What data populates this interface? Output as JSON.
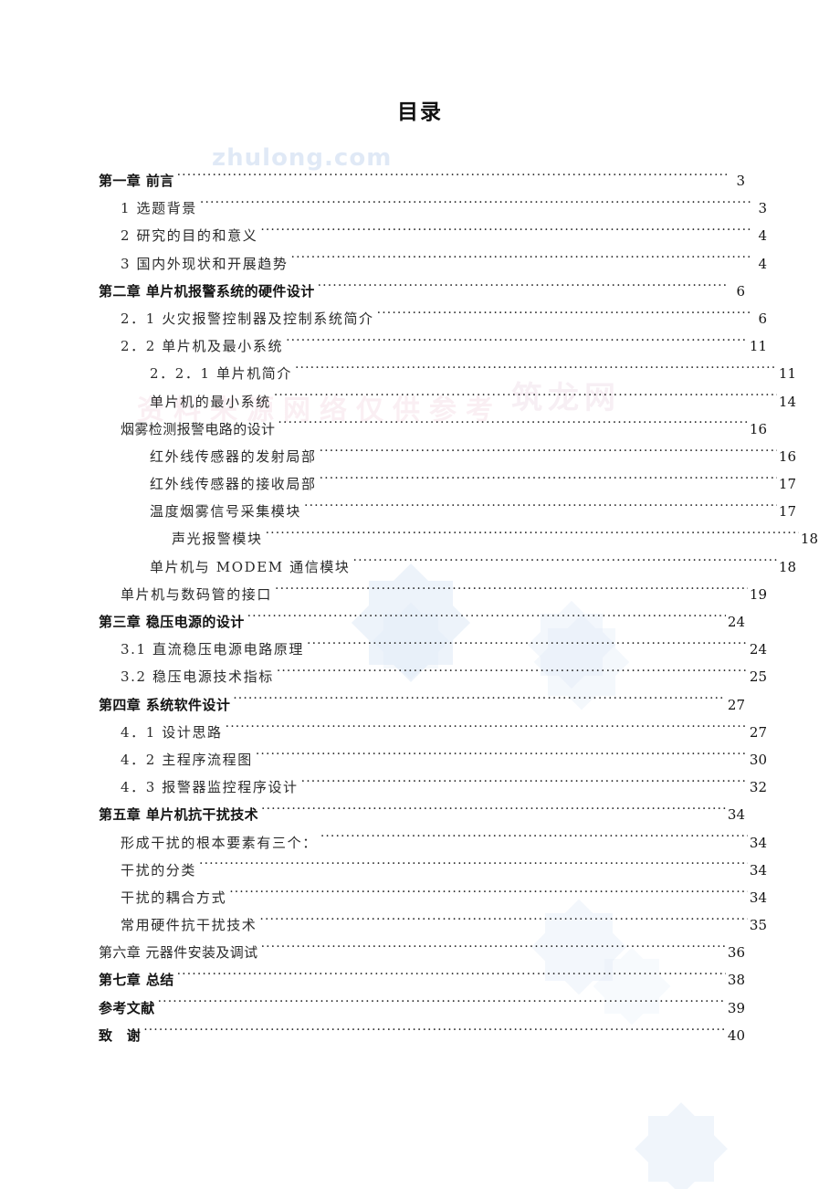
{
  "document": {
    "title": "目录",
    "watermarks": {
      "site": "zhulong.com",
      "band_left": "资料来源网络仅供参考",
      "band_right": "筑龙网"
    }
  },
  "toc": {
    "entries": [
      {
        "label": "第一章  前言",
        "page": "3",
        "level": 0,
        "bold": true,
        "tight": true
      },
      {
        "label": "1 选题背景",
        "page": "3",
        "level": 1,
        "bold": false,
        "tight": false
      },
      {
        "label": "2 研究的目的和意义",
        "page": "4",
        "level": 1,
        "bold": false,
        "tight": false
      },
      {
        "label": "3 国内外现状和开展趋势",
        "page": "4",
        "level": 1,
        "bold": false,
        "tight": false
      },
      {
        "label": "第二章  单片机报警系统的硬件设计",
        "page": "6",
        "level": 0,
        "bold": true,
        "tight": true
      },
      {
        "label": "2．1 火灾报警控制器及控制系统简介",
        "page": "6",
        "level": 1,
        "bold": false,
        "tight": false
      },
      {
        "label": "2．2 单片机及最小系统",
        "page": "11",
        "level": 1,
        "bold": false,
        "tight": false
      },
      {
        "label": "2．2．1 单片机简介",
        "page": "11",
        "level": 2,
        "bold": false,
        "tight": false
      },
      {
        "label": "单片机的最小系统",
        "page": "14",
        "level": 2,
        "bold": false,
        "tight": false
      },
      {
        "label": "烟雾检测报警电路的设计",
        "page": "16",
        "level": 1,
        "bold": false,
        "tight": true
      },
      {
        "label": "红外线传感器的发射局部",
        "page": "16",
        "level": 2,
        "bold": false,
        "tight": false
      },
      {
        "label": "红外线传感器的接收局部",
        "page": "17",
        "level": 2,
        "bold": false,
        "tight": false
      },
      {
        "label": "温度烟雾信号采集模块",
        "page": "17",
        "level": 2,
        "bold": false,
        "tight": false
      },
      {
        "label": "声光报警模块",
        "page": "18",
        "level": 3,
        "bold": false,
        "tight": false
      },
      {
        "label": "单片机与 MODEM 通信模块",
        "page": "18",
        "level": 2,
        "bold": false,
        "tight": false
      },
      {
        "label": "单片机与数码管的接口",
        "page": "19",
        "level": 1,
        "bold": false,
        "tight": false
      },
      {
        "label": "第三章   稳压电源的设计",
        "page": "24",
        "level": 0,
        "bold": true,
        "tight": true
      },
      {
        "label": "3.1  直流稳压电源电路原理",
        "page": "24",
        "level": 1,
        "bold": false,
        "tight": false
      },
      {
        "label": "3.2  稳压电源技术指标",
        "page": "25",
        "level": 1,
        "bold": false,
        "tight": false
      },
      {
        "label": "第四章     系统软件设计",
        "page": "27",
        "level": 0,
        "bold": true,
        "tight": true
      },
      {
        "label": "4．1 设计思路",
        "page": "27",
        "level": 1,
        "bold": false,
        "tight": false
      },
      {
        "label": "4．2 主程序流程图",
        "page": "30",
        "level": 1,
        "bold": false,
        "tight": false
      },
      {
        "label": "4．3 报警器监控程序设计",
        "page": "32",
        "level": 1,
        "bold": false,
        "tight": false
      },
      {
        "label": "第五章  单片机抗干扰技术",
        "page": "34",
        "level": 0,
        "bold": true,
        "tight": true
      },
      {
        "label": "形成干扰的根本要素有三个：",
        "page": "34",
        "level": 1,
        "bold": false,
        "tight": false
      },
      {
        "label": "干扰的分类",
        "page": "34",
        "level": 1,
        "bold": false,
        "tight": false
      },
      {
        "label": "干扰的耦合方式",
        "page": "34",
        "level": 1,
        "bold": false,
        "tight": false
      },
      {
        "label": "常用硬件抗干扰技术",
        "page": "35",
        "level": 1,
        "bold": false,
        "tight": false
      },
      {
        "label": "第六章   元器件安装及调试",
        "page": "36",
        "level": 0,
        "bold": false,
        "tight": true
      },
      {
        "label": "第七章  总结",
        "page": "38",
        "level": 0,
        "bold": true,
        "tight": true
      },
      {
        "label": "参考文献",
        "page": "39",
        "level": 0,
        "bold": true,
        "tight": true
      },
      {
        "label": "致　谢",
        "page": "40",
        "level": 0,
        "bold": true,
        "tight": true
      }
    ]
  }
}
